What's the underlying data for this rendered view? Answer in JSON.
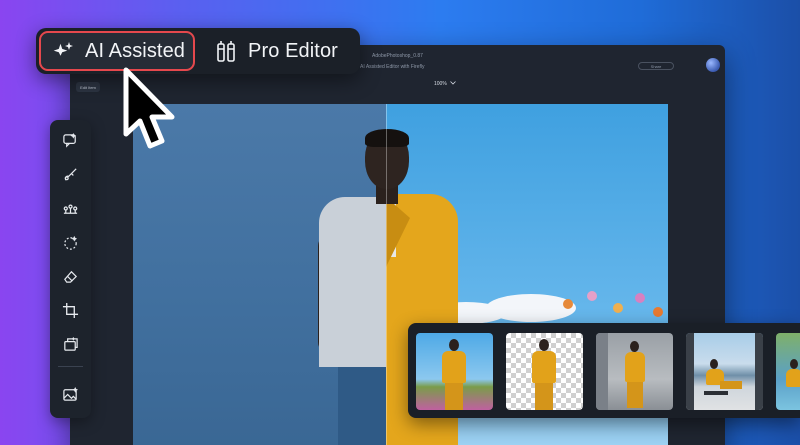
{
  "mode_switcher": {
    "ai_assisted_label": "AI Assisted",
    "ai_assisted_icon": "sparkles-icon",
    "pro_editor_label": "Pro Editor",
    "pro_editor_icon": "tools-icon",
    "active_mode": "AI Assisted",
    "active_border_color": "#e5484d"
  },
  "editor_window": {
    "title": "AdobePhotoshop_0.87",
    "firefly_note": "AI Assisted Editor with Firefly",
    "share_label": "Share",
    "edit_tab_label": "Edit Item",
    "zoom_label": "100%"
  },
  "tool_rail": {
    "tools": [
      {
        "name": "generative-chat-icon"
      },
      {
        "name": "brush-edit-icon"
      },
      {
        "name": "adjustments-sliders-icon"
      },
      {
        "name": "magic-select-icon"
      },
      {
        "name": "eraser-icon"
      },
      {
        "name": "crop-icon"
      },
      {
        "name": "expand-image-icon"
      },
      {
        "name": "generate-image-icon"
      }
    ]
  },
  "variations": {
    "items": [
      {
        "name": "variation-flower-field",
        "background": "sky-flowers"
      },
      {
        "name": "variation-background-removed",
        "background": "transparent"
      },
      {
        "name": "variation-concrete-room",
        "background": "concrete"
      },
      {
        "name": "variation-seated-lakeside",
        "background": "lake-mountains"
      },
      {
        "name": "variation-pool",
        "background": "pool"
      }
    ]
  },
  "colors": {
    "accent_red": "#e5484d",
    "suit_yellow": "#e4a61c",
    "panel_dark": "#1b2028"
  }
}
